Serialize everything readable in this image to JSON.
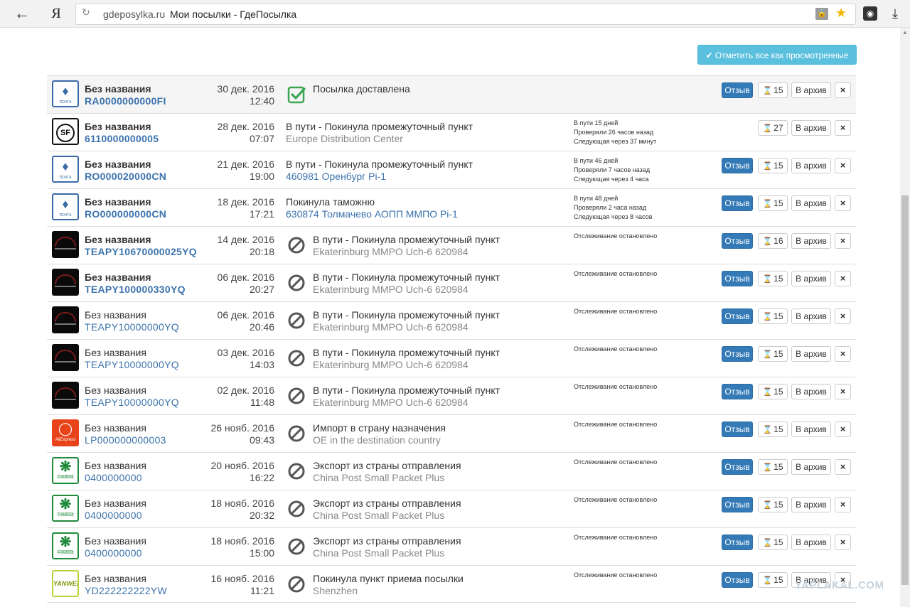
{
  "browser": {
    "back_icon": "arrow-left-icon",
    "yandex_logo": "Я",
    "domain": "gdeposylka.ru",
    "title": "Мои посылки - ГдеПосылка"
  },
  "mark_all_label": "Отметить все как просмотренные",
  "buttons": {
    "review": "Отзыв",
    "archive": "В архив",
    "close": "×"
  },
  "parcels": [
    {
      "logo": "russian-post",
      "name": "Без названия",
      "track": "RA0000000000FI",
      "date": "30 дек. 2016",
      "time": "12:40",
      "status": "delivered",
      "title": "Посылка доставлена",
      "subtitle": "",
      "info": [],
      "review": true,
      "count": "15",
      "bold": true
    },
    {
      "logo": "sf-express",
      "name": "Без названия",
      "track": "6110000000005",
      "date": "28 дек. 2016",
      "time": "07:07",
      "status": "none",
      "title": "В пути - Покинула промежуточный пункт",
      "subtitle": "Europe Distribution Center",
      "sub_link": false,
      "info": [
        "В пути 15 дней",
        "Проверяли 26 часов назад",
        "Следующая через 37 минут"
      ],
      "review": false,
      "count": "27",
      "bold": true
    },
    {
      "logo": "russian-post",
      "name": "Без названия",
      "track": "RO000020000CN",
      "date": "21 дек. 2016",
      "time": "19:00",
      "status": "none",
      "title": "В пути - Покинула промежуточный пункт",
      "subtitle": "460981 Оренбург Pi-1",
      "sub_link": true,
      "info": [
        "В пути 46 дней",
        "Проверяли 7 часов назад",
        "Следующая через 4 часа"
      ],
      "review": true,
      "count": "15",
      "bold": true
    },
    {
      "logo": "russian-post",
      "name": "Без названия",
      "track": "RO000000000CN",
      "date": "18 дек. 2016",
      "time": "17:21",
      "status": "none",
      "title": "Покинула таможню",
      "subtitle": "630874 Толмачево АОПП ММПО Pi-1",
      "sub_link": true,
      "info": [
        "В пути 48 дней",
        "Проверяли 2 часа назад",
        "Следующая через 8 часов"
      ],
      "review": true,
      "count": "15",
      "bold": true
    },
    {
      "logo": "dark",
      "name": "Без названия",
      "track": "TEAPY10670000025YQ",
      "date": "14 дек. 2016",
      "time": "20:18",
      "status": "stopped",
      "title": "В пути - Покинула промежуточный пункт",
      "subtitle": "Ekaterinburg MMPO Uch-6 620984",
      "info": [
        "Отслеживание остановлено"
      ],
      "review": true,
      "count": "16",
      "bold": true
    },
    {
      "logo": "dark",
      "name": "Без названия",
      "track": "TEAPY100000330YQ",
      "date": "06 дек. 2016",
      "time": "20:27",
      "status": "stopped",
      "title": "В пути - Покинула промежуточный пункт",
      "subtitle": "Ekaterinburg MMPO Uch-6 620984",
      "info": [
        "Отслеживание остановлено"
      ],
      "review": true,
      "count": "15",
      "bold": true
    },
    {
      "logo": "dark",
      "name": "Без названия",
      "track": "TEAPY10000000YQ",
      "date": "06 дек. 2016",
      "time": "20:46",
      "status": "stopped",
      "title": "В пути - Покинула промежуточный пункт",
      "subtitle": "Ekaterinburg MMPO Uch-6 620984",
      "info": [
        "Отслеживание остановлено"
      ],
      "review": true,
      "count": "15",
      "bold": false
    },
    {
      "logo": "dark",
      "name": "Без названия",
      "track": "TEAPY10000000YQ",
      "date": "03 дек. 2016",
      "time": "14:03",
      "status": "stopped",
      "title": "В пути - Покинула промежуточный пункт",
      "subtitle": "Ekaterinburg MMPO Uch-6 620984",
      "info": [
        "Отслеживание остановлено"
      ],
      "review": true,
      "count": "15",
      "bold": false
    },
    {
      "logo": "dark",
      "name": "Без названия",
      "track": "TEAPY10000000YQ",
      "date": "02 дек. 2016",
      "time": "11:48",
      "status": "stopped",
      "title": "В пути - Покинула промежуточный пункт",
      "subtitle": "Ekaterinburg MMPO Uch-6 620984",
      "info": [
        "Отслеживание остановлено"
      ],
      "review": true,
      "count": "15",
      "bold": false
    },
    {
      "logo": "aliexpress",
      "name": "Без названия",
      "track": "LP000000000003",
      "date": "26 нояб. 2016",
      "time": "09:43",
      "status": "stopped",
      "title": "Импорт в страну назначения",
      "subtitle": "OE in the destination country",
      "info": [
        "Отслеживание остановлено"
      ],
      "review": true,
      "count": "15",
      "bold": false
    },
    {
      "logo": "china-post",
      "name": "Без названия",
      "track": "0400000000",
      "date": "20 нояб. 2016",
      "time": "16:22",
      "status": "stopped",
      "title": "Экспорт из страны отправления",
      "subtitle": "China Post Small Packet Plus",
      "info": [
        "Отслеживание остановлено"
      ],
      "review": true,
      "count": "15",
      "bold": false
    },
    {
      "logo": "china-post",
      "name": "Без названия",
      "track": "0400000000",
      "date": "18 нояб. 2016",
      "time": "20:32",
      "status": "stopped",
      "title": "Экспорт из страны отправления",
      "subtitle": "China Post Small Packet Plus",
      "info": [
        "Отслеживание остановлено"
      ],
      "review": true,
      "count": "15",
      "bold": false
    },
    {
      "logo": "china-post",
      "name": "Без названия",
      "track": "0400000000",
      "date": "18 нояб. 2016",
      "time": "15:00",
      "status": "stopped",
      "title": "Экспорт из страны отправления",
      "subtitle": "China Post Small Packet Plus",
      "info": [
        "Отслеживание остановлено"
      ],
      "review": true,
      "count": "15",
      "bold": false
    },
    {
      "logo": "yanwen",
      "name": "Без названия",
      "track": "YD222222222YW",
      "date": "16 нояб. 2016",
      "time": "11:21",
      "status": "stopped",
      "title": "Покинула пункт приема посылки",
      "subtitle": "Shenzhen",
      "info": [
        "Отслеживание остановлено"
      ],
      "review": true,
      "count": "15",
      "bold": false
    }
  ],
  "watermark": "YAPLAKAL.COM"
}
